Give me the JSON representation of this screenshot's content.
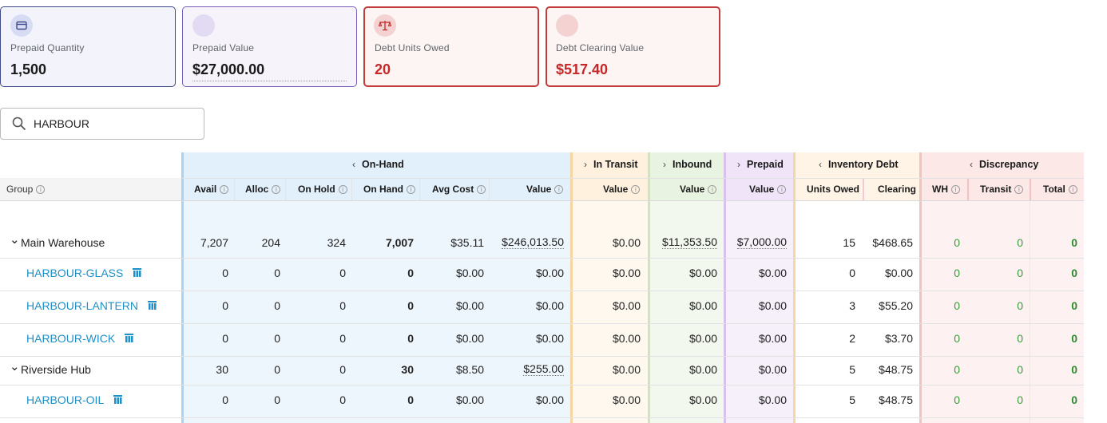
{
  "kpis": {
    "prepaid_quantity": {
      "label": "Prepaid Quantity",
      "value": "1,500",
      "icon": "credit-card-icon"
    },
    "prepaid_value": {
      "label": "Prepaid Value",
      "value": "$27,000.00",
      "icon": "circle-icon"
    },
    "debt_units_owed": {
      "label": "Debt Units Owed",
      "value": "20",
      "icon": "scale-icon"
    },
    "debt_clearing_value": {
      "label": "Debt Clearing Value",
      "value": "$517.40",
      "icon": "circle-icon"
    }
  },
  "search": {
    "value": "HARBOUR",
    "icon": "search-icon"
  },
  "table": {
    "column_groups": {
      "on_hand": "On-Hand",
      "in_transit": "In Transit",
      "inbound": "Inbound",
      "prepaid": "Prepaid",
      "inventory_debt": "Inventory Debt",
      "discrepancy": "Discrepancy"
    },
    "columns": {
      "group": "Group",
      "avail": "Avail",
      "alloc": "Alloc",
      "on_hold": "On Hold",
      "on_hand": "On Hand",
      "avg_cost": "Avg Cost",
      "value": "Value",
      "transit_value": "Value",
      "inbound_value": "Value",
      "prepaid_value": "Value",
      "units_owed": "Units Owed",
      "clearing": "Clearing",
      "wh": "WH",
      "transit": "Transit",
      "total": "Total"
    },
    "rows": [
      {
        "name": "Main Warehouse",
        "avail": "7,207",
        "alloc": "204",
        "on_hold": "324",
        "on_hand": "7,007",
        "avg_cost": "$35.11",
        "value": "$246,013.50",
        "transit_value": "$0.00",
        "inbound_value": "$11,353.50",
        "prepaid_value": "$7,000.00",
        "units_owed": "15",
        "clearing": "$468.65",
        "wh": "0",
        "transit": "0",
        "total": "0"
      },
      {
        "name": "HARBOUR-GLASS",
        "avail": "0",
        "alloc": "0",
        "on_hold": "0",
        "on_hand": "0",
        "avg_cost": "$0.00",
        "value": "$0.00",
        "transit_value": "$0.00",
        "inbound_value": "$0.00",
        "prepaid_value": "$0.00",
        "units_owed": "0",
        "clearing": "$0.00",
        "wh": "0",
        "transit": "0",
        "total": "0"
      },
      {
        "name": "HARBOUR-LANTERN",
        "avail": "0",
        "alloc": "0",
        "on_hold": "0",
        "on_hand": "0",
        "avg_cost": "$0.00",
        "value": "$0.00",
        "transit_value": "$0.00",
        "inbound_value": "$0.00",
        "prepaid_value": "$0.00",
        "units_owed": "3",
        "clearing": "$55.20",
        "wh": "0",
        "transit": "0",
        "total": "0"
      },
      {
        "name": "HARBOUR-WICK",
        "avail": "0",
        "alloc": "0",
        "on_hold": "0",
        "on_hand": "0",
        "avg_cost": "$0.00",
        "value": "$0.00",
        "transit_value": "$0.00",
        "inbound_value": "$0.00",
        "prepaid_value": "$0.00",
        "units_owed": "2",
        "clearing": "$3.70",
        "wh": "0",
        "transit": "0",
        "total": "0"
      },
      {
        "name": "Riverside Hub",
        "avail": "30",
        "alloc": "0",
        "on_hold": "0",
        "on_hand": "30",
        "avg_cost": "$8.50",
        "value": "$255.00",
        "transit_value": "$0.00",
        "inbound_value": "$0.00",
        "prepaid_value": "$0.00",
        "units_owed": "5",
        "clearing": "$48.75",
        "wh": "0",
        "transit": "0",
        "total": "0"
      },
      {
        "name": "HARBOUR-OIL",
        "avail": "0",
        "alloc": "0",
        "on_hold": "0",
        "on_hand": "0",
        "avg_cost": "$0.00",
        "value": "$0.00",
        "transit_value": "$0.00",
        "inbound_value": "$0.00",
        "prepaid_value": "$0.00",
        "units_owed": "5",
        "clearing": "$48.75",
        "wh": "0",
        "transit": "0",
        "total": "0"
      }
    ]
  },
  "colors": {
    "on_hand_bg": "#eef6fd",
    "on_hand_header": "#e2f0fc",
    "on_hand_line": "#a9d2f3",
    "in_transit_bg": "#fff8ee",
    "in_transit_header": "#fff1de",
    "in_transit_line": "#f6d5a3",
    "inbound_bg": "#f3f8ee",
    "inbound_header": "#e9f3e2",
    "inbound_line": "#cfe4bf",
    "prepaid_bg": "#f6f0fb",
    "prepaid_header": "#efe4f8",
    "prepaid_line": "#d8c1ee",
    "debt_header": "#fff4e5",
    "debt_line": "#f5d6a6",
    "discrepancy_bg": "#fdf1f1",
    "discrepancy_header": "#fde8e8",
    "discrepancy_line": "#f2c2c2",
    "link": "#1f8fc7",
    "positive": "#3a9b3a"
  }
}
